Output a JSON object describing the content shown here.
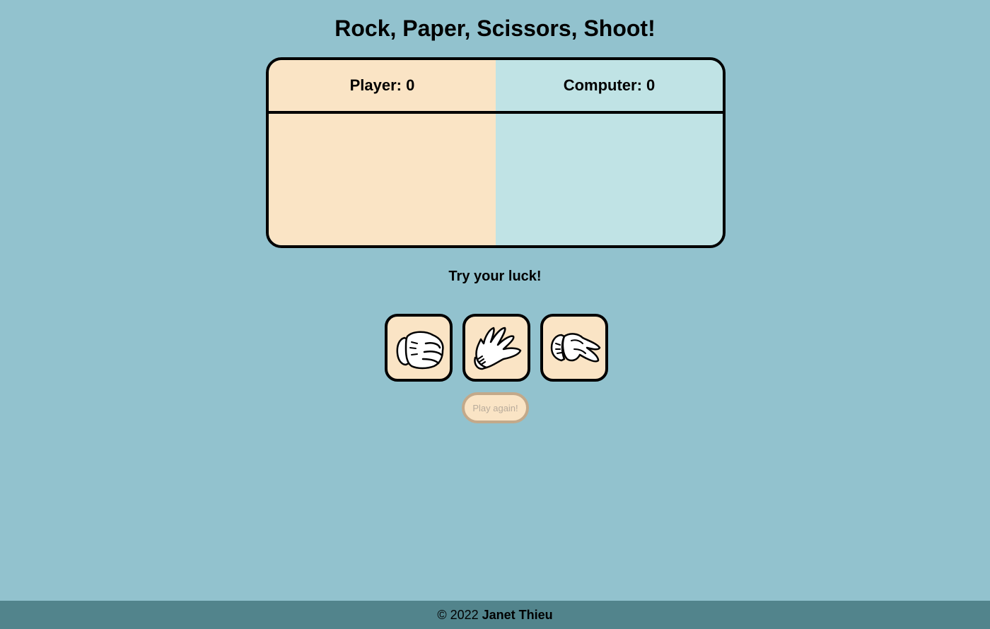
{
  "title": "Rock, Paper, Scissors, Shoot!",
  "scoreboard": {
    "player_label": "Player: 0",
    "computer_label": "Computer: 0",
    "player_score": 0,
    "computer_score": 0
  },
  "message": "Try your luck!",
  "choices": [
    {
      "name": "rock",
      "icon": "rock-hand-icon"
    },
    {
      "name": "paper",
      "icon": "paper-hand-icon"
    },
    {
      "name": "scissors",
      "icon": "scissors-hand-icon"
    }
  ],
  "play_again_label": "Play again!",
  "play_again_enabled": false,
  "footer": {
    "copyright": "© 2022",
    "author": "Janet Thieu"
  },
  "colors": {
    "background": "#92c2ce",
    "player_panel": "#fae4c5",
    "computer_panel": "#c0e3e5",
    "footer": "#52848c"
  }
}
